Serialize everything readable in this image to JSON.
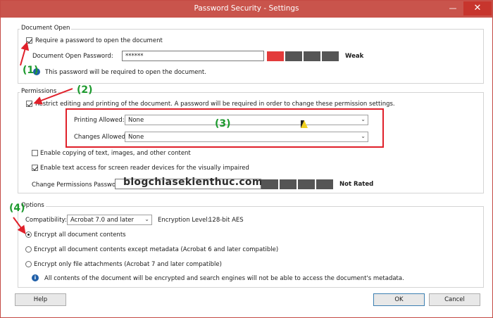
{
  "window": {
    "title": "Password Security - Settings",
    "minimize": "—",
    "close": "✕"
  },
  "document_open": {
    "title": "Document Open",
    "require_label": "Require a password to open the document",
    "password_label": "Document Open Password:",
    "password_value": "******",
    "strength": "Weak",
    "info": "This password will be required to open the document."
  },
  "permissions": {
    "title": "Permissions",
    "restrict_label": "Restrict editing and printing of the document. A password will be required in order to change these permission settings.",
    "printing_label": "Printing Allowed:",
    "printing_value": "None",
    "changes_label": "Changes Allowed:",
    "changes_value": "None",
    "copy_label": "Enable copying of text, images, and other content",
    "screen_reader_label": "Enable text access for screen reader devices for the visually impaired",
    "change_password_label": "Change Permissions Password:",
    "rating": "Not Rated"
  },
  "options": {
    "title": "Options",
    "compat_label": "Compatibility:",
    "compat_value": "Acrobat 7.0 and later",
    "enc_label": "Encryption  Level:",
    "enc_value": "128-bit AES",
    "radio1": "Encrypt all document contents",
    "radio2": "Encrypt all document contents except metadata (Acrobat 6 and later compatible)",
    "radio3": "Encrypt only file attachments (Acrobat 7 and later compatible)",
    "info": "All contents of the document will be encrypted and search engines will not be able to access the document's metadata."
  },
  "buttons": {
    "help": "Help",
    "ok": "OK",
    "cancel": "Cancel"
  },
  "annotations": {
    "a1": "(1)",
    "a2": "(2)",
    "a3": "(3)",
    "a4": "(4)"
  },
  "watermark": "blogchiasekienthuc.com",
  "colors": {
    "title_bar": "#c9544c",
    "annotation_green": "#1d9a2e",
    "highlight_red": "#e0202a",
    "meter_weak": "#e33b3b"
  }
}
